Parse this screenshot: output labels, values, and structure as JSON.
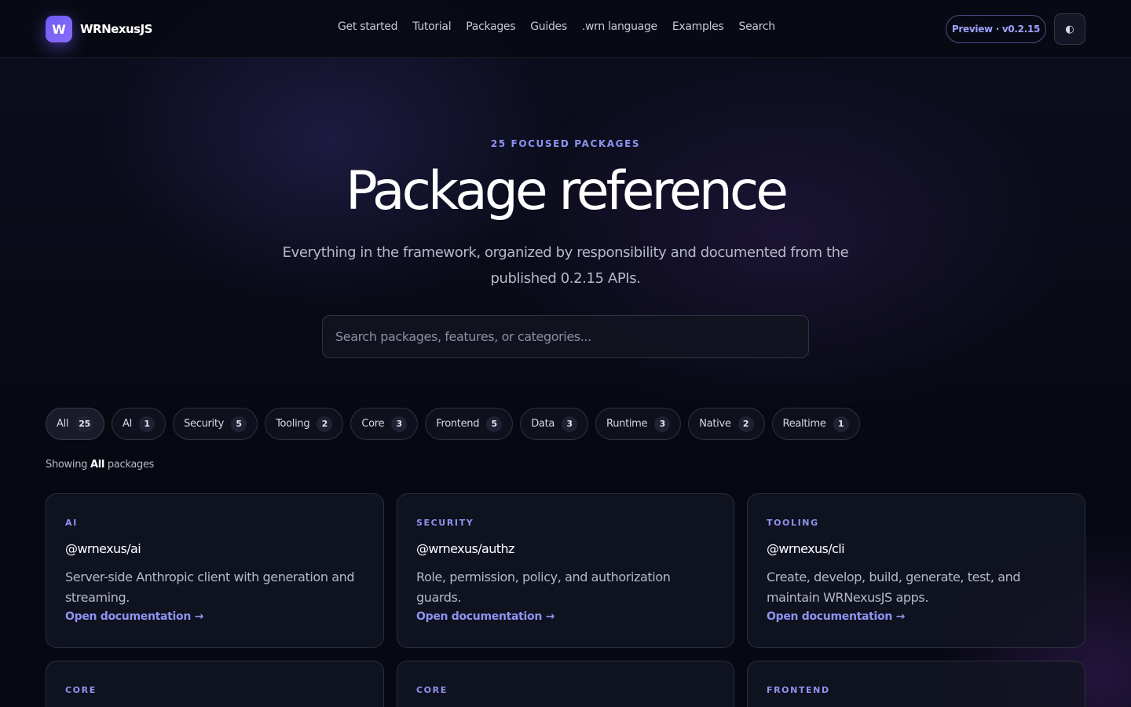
{
  "brand": {
    "logo_letter": "W",
    "name": "WRNexusJS"
  },
  "nav": {
    "links": [
      "Get started",
      "Tutorial",
      "Packages",
      "Guides",
      ".wrn language",
      "Examples",
      "Search"
    ],
    "version_label": "Preview · v0.2.15",
    "theme_toggle_glyph": "◐"
  },
  "hero": {
    "eyebrow": "25 FOCUSED PACKAGES",
    "title": "Package reference",
    "subtitle": "Everything in the framework, organized by responsibility and documented from the published 0.2.15 APIs.",
    "search_placeholder": "Search packages, features, or categories..."
  },
  "filters": [
    {
      "label": "All",
      "count": "25",
      "active": true
    },
    {
      "label": "AI",
      "count": "1"
    },
    {
      "label": "Security",
      "count": "5"
    },
    {
      "label": "Tooling",
      "count": "2"
    },
    {
      "label": "Core",
      "count": "3"
    },
    {
      "label": "Frontend",
      "count": "5"
    },
    {
      "label": "Data",
      "count": "3"
    },
    {
      "label": "Runtime",
      "count": "3"
    },
    {
      "label": "Native",
      "count": "2"
    },
    {
      "label": "Realtime",
      "count": "1"
    }
  ],
  "showing": {
    "prefix": "Showing",
    "filter": "All",
    "suffix": "packages"
  },
  "cards": [
    {
      "category": "AI",
      "name": "@wrnexus/ai",
      "description": "Server-side Anthropic client with generation and streaming.",
      "link": "Open documentation →"
    },
    {
      "category": "SECURITY",
      "name": "@wrnexus/authz",
      "description": "Role, permission, policy, and authorization guards.",
      "link": "Open documentation →"
    },
    {
      "category": "TOOLING",
      "name": "@wrnexus/cli",
      "description": "Create, develop, build, generate, test, and maintain WRNexusJS apps.",
      "link": "Open documentation →"
    },
    {
      "category": "CORE"
    },
    {
      "category": "CORE"
    },
    {
      "category": "FRONTEND"
    }
  ]
}
